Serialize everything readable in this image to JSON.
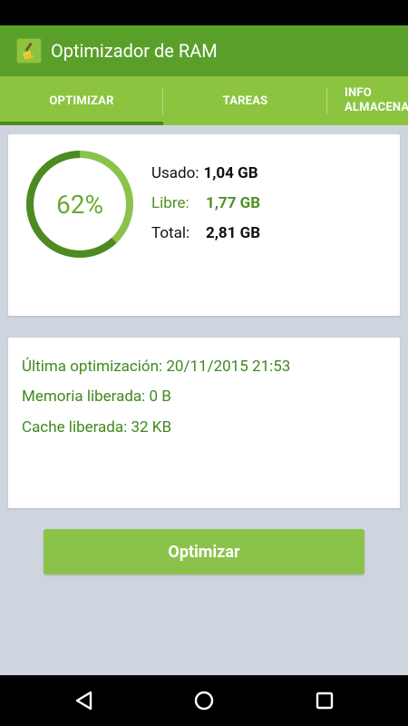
{
  "app": {
    "title": "Optimizador de RAM",
    "icon": "broom-icon"
  },
  "tabs": [
    {
      "label": "OPTIMIZAR",
      "active": true
    },
    {
      "label": "TAREAS",
      "active": false
    },
    {
      "label": "INFO ALMACENAMIENTO",
      "active": false
    }
  ],
  "memory": {
    "percent_label": "62%",
    "used_fraction": 0.62,
    "used_label": "Usado:",
    "used_value": "1,04 GB",
    "free_label": "Libre:",
    "free_value": "1,77 GB",
    "total_label": "Total:",
    "total_value": "2,81 GB"
  },
  "info": {
    "last_optimization": "Última optimización: 20/11/2015 21:53",
    "memory_freed": "Memoria liberada: 0 B",
    "cache_freed": "Cache liberada: 32 KB"
  },
  "action": {
    "optimize_label": "Optimizar"
  },
  "colors": {
    "app_bar": "#5b9f2b",
    "tab_bar": "#8cc43f",
    "tab_indicator": "#4a8a22",
    "ring_light": "#8bc34a",
    "ring_dark": "#4c8a22",
    "accent_text": "#4f9122",
    "button": "#8bc34a",
    "background": "#cfd5df"
  },
  "nav": {
    "back_icon": "back-triangle-icon",
    "home_icon": "home-circle-icon",
    "recent_icon": "recent-apps-square-icon"
  }
}
